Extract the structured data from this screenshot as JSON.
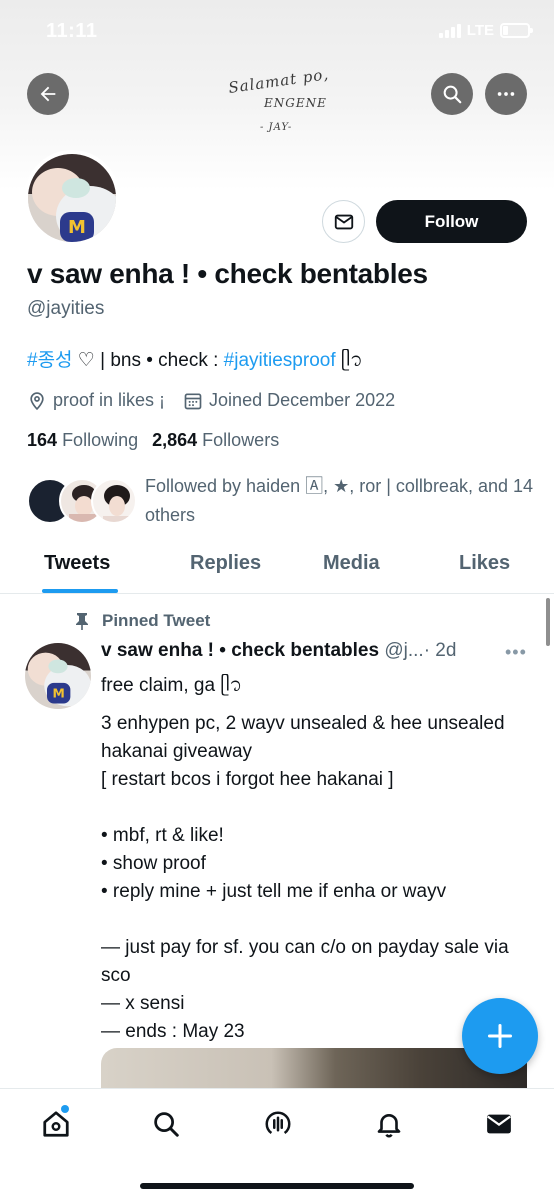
{
  "status_bar": {
    "time": "11:11",
    "network": "LTE"
  },
  "banner": {
    "line1": "Salamat po,",
    "line2": "ENGENE",
    "line3": "- JAY-"
  },
  "profile": {
    "display_name": "v saw enha ! • check bentables",
    "handle": "@jayities",
    "bio_hashtag1": "#종성",
    "bio_text": " ♡ | bns • check : ",
    "bio_hashtag2": "#jayitiesproof",
    "bio_emoji": " ᥫ᭡",
    "location": "proof in likes ¡",
    "joined": "Joined December 2022",
    "following_count": "164",
    "following_label": "Following",
    "followers_count": "2,864",
    "followers_label": "Followers",
    "followed_by": "Followed by haiden 🄰, ★, ror | collbreak, and 14 others",
    "follow_label": "Follow"
  },
  "tabs": [
    {
      "label": "Tweets"
    },
    {
      "label": "Replies"
    },
    {
      "label": "Media"
    },
    {
      "label": "Likes"
    }
  ],
  "tweet": {
    "pinned_label": "Pinned Tweet",
    "author_name": "v saw enha ! • check bentables",
    "author_handle": "@j...",
    "time": "· 2d",
    "more": "•••",
    "lines": [
      "free claim, ga ᥫ᭡",
      "",
      "3 enhypen pc, 2 wayv unsealed & hee unsealed hakanai giveaway",
      "[ restart bcos i forgot hee hakanai ]",
      "",
      "• mbf, rt & like!",
      "• show proof",
      "• reply mine + just tell me if enha or wayv",
      "",
      "— just pay for sf. you can c/o on payday sale via sco",
      "— x sensi",
      "— ends : May 23"
    ]
  },
  "colors": {
    "accent": "#1d9bf0",
    "text": "#0f1419",
    "muted": "#536471"
  },
  "icons": [
    "back-arrow-icon",
    "search-icon",
    "more-icon",
    "mail-icon",
    "location-icon",
    "calendar-icon",
    "pin-icon",
    "plus-icon",
    "home-icon",
    "spaces-icon",
    "bell-icon",
    "messages-icon"
  ]
}
